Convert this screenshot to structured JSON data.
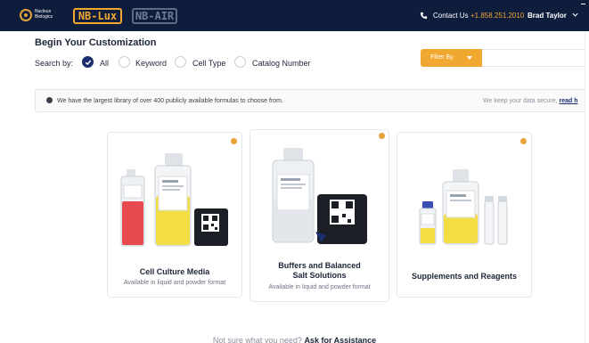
{
  "topbar": {
    "logo_text": "Nucleus Biologics",
    "badge_lux": "NB-Lux",
    "badge_air": "NB-AIR",
    "contact_label": "Contact Us",
    "contact_phone": "+1.858.251.2010",
    "user_name": "Brad Taylor"
  },
  "search": {
    "title": "Begin Your Customization",
    "label": "Search by:",
    "options": [
      {
        "label": "All",
        "selected": true
      },
      {
        "label": "Keyword",
        "selected": false
      },
      {
        "label": "Cell Type",
        "selected": false
      },
      {
        "label": "Catalog Number",
        "selected": false
      }
    ],
    "filter_label": "Filter By"
  },
  "banner": {
    "info": "We have the largest library of over 400 publicly available formulas to choose from.",
    "secure": "We keep your data secure,",
    "secure_link": "read h"
  },
  "cards": [
    {
      "title": "Cell Culture Media",
      "subtitle": "Available in liquid and powder format"
    },
    {
      "title_line1": "Buffers and Balanced",
      "title_line2": "Salt Solutions",
      "subtitle": "Available in liquid and powder format"
    },
    {
      "title": "Supplements and Reagents"
    }
  ],
  "footer": {
    "prompt": "Not sure what you need?",
    "link": "Ask for Assistance"
  },
  "colors": {
    "nav_bg": "#0f1d3d",
    "accent": "#f0a830",
    "primary": "#1b2f6e"
  }
}
